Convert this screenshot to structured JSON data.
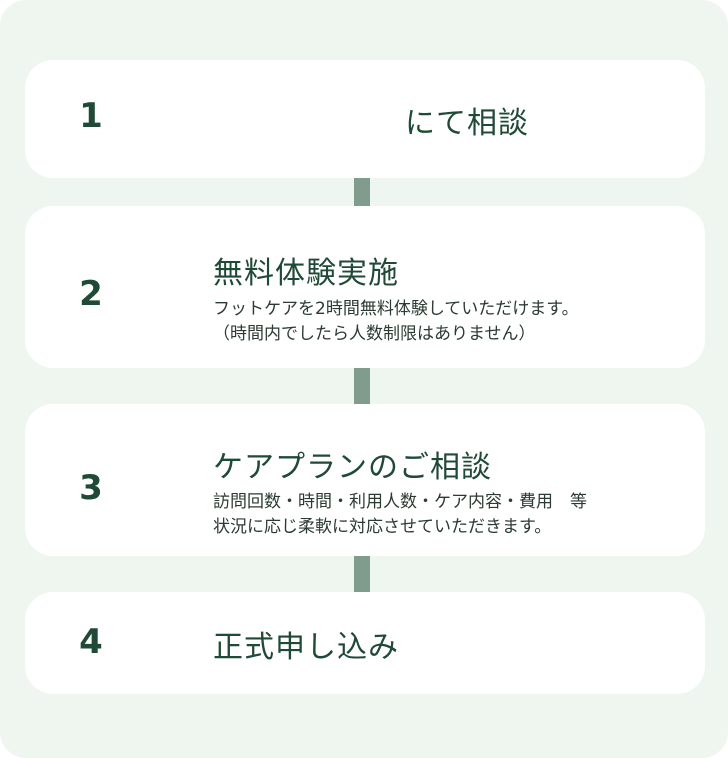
{
  "steps": [
    {
      "number": "1",
      "title": "にて相談",
      "lines": []
    },
    {
      "number": "2",
      "title": "無料体験実施",
      "lines": [
        "フットケアを2時間無料体験していただけます。",
        "（時間内でしたら人数制限はありません）"
      ]
    },
    {
      "number": "3",
      "title": "ケアプランのご相談",
      "lines": [
        "訪問回数・時間・利用人数・ケア内容・費用　等",
        "状況に応じ柔軟に対応させていただきます。"
      ]
    },
    {
      "number": "4",
      "title": "正式申し込み",
      "lines": []
    }
  ],
  "colors": {
    "panel": "#eff5ef",
    "card": "#ffffff",
    "connector": "#7f9c8c",
    "accent": "#1f4a35"
  }
}
